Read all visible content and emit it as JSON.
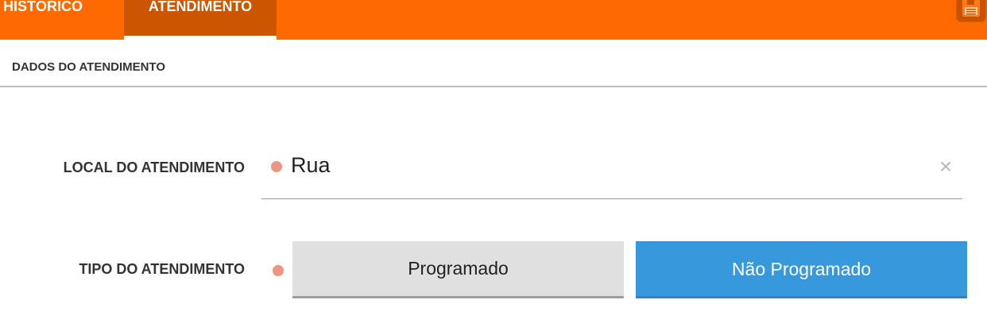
{
  "tabs": [
    {
      "label": "HISTÓRICO",
      "active": false
    },
    {
      "label": "ATENDIMENTO",
      "active": true
    }
  ],
  "toolbar": {
    "save_icon": "save-icon"
  },
  "section": {
    "title": "DADOS DO ATENDIMENTO"
  },
  "local": {
    "label": "LOCAL DO ATENDIMENTO",
    "value": "Rua",
    "clear_label": "×",
    "required": true
  },
  "tipo": {
    "label": "TIPO DO ATENDIMENTO",
    "options": [
      "Programado",
      "Não Programado"
    ],
    "selected": "Não Programado",
    "required": true
  },
  "colors": {
    "topbar": "#ff6a00",
    "active_tab": "#cc5500",
    "required_dot": "#ef9382",
    "selected_option": "#3898dc",
    "unselected_option": "#e0e0e0"
  }
}
